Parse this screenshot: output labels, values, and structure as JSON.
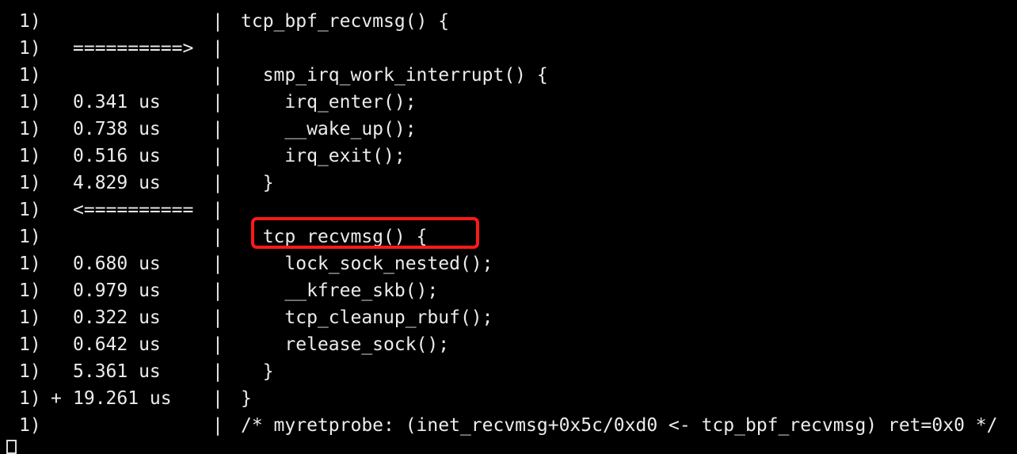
{
  "terminal": {
    "lines": [
      {
        "cpu": "1)",
        "flag": "",
        "duration": "",
        "bar": "|",
        "code": "tcp_bpf_recvmsg() {"
      },
      {
        "cpu": "1)",
        "flag": "",
        "duration": "==========>",
        "bar": "|",
        "code": ""
      },
      {
        "cpu": "1)",
        "flag": "",
        "duration": "",
        "bar": "|",
        "code": "  smp_irq_work_interrupt() {"
      },
      {
        "cpu": "1)",
        "flag": "",
        "duration": "0.341 us",
        "bar": "|",
        "code": "    irq_enter();"
      },
      {
        "cpu": "1)",
        "flag": "",
        "duration": "0.738 us",
        "bar": "|",
        "code": "    __wake_up();"
      },
      {
        "cpu": "1)",
        "flag": "",
        "duration": "0.516 us",
        "bar": "|",
        "code": "    irq_exit();"
      },
      {
        "cpu": "1)",
        "flag": "",
        "duration": "4.829 us",
        "bar": "|",
        "code": "  }"
      },
      {
        "cpu": "1)",
        "flag": "",
        "duration": "<==========",
        "bar": "|",
        "code": ""
      },
      {
        "cpu": "1)",
        "flag": "",
        "duration": "",
        "bar": "|",
        "code": "  tcp_recvmsg() {"
      },
      {
        "cpu": "1)",
        "flag": "",
        "duration": "0.680 us",
        "bar": "|",
        "code": "    lock_sock_nested();"
      },
      {
        "cpu": "1)",
        "flag": "",
        "duration": "0.979 us",
        "bar": "|",
        "code": "    __kfree_skb();"
      },
      {
        "cpu": "1)",
        "flag": "",
        "duration": "0.322 us",
        "bar": "|",
        "code": "    tcp_cleanup_rbuf();"
      },
      {
        "cpu": "1)",
        "flag": "",
        "duration": "0.642 us",
        "bar": "|",
        "code": "    release_sock();"
      },
      {
        "cpu": "1)",
        "flag": "",
        "duration": "5.361 us",
        "bar": "|",
        "code": "  }"
      },
      {
        "cpu": "1)",
        "flag": "+",
        "duration": "19.261 us",
        "bar": "|",
        "code": "}"
      },
      {
        "cpu": "1)",
        "flag": "",
        "duration": "",
        "bar": "|",
        "code": "/* myretprobe: (inet_recvmsg+0x5c/0xd0 <- tcp_bpf_recvmsg) ret=0x0 */"
      }
    ],
    "highlighted_call": "tcp_recvmsg() {",
    "colors": {
      "background": "#000000",
      "text": "#ececec",
      "highlight": "#ff1a1a"
    }
  }
}
